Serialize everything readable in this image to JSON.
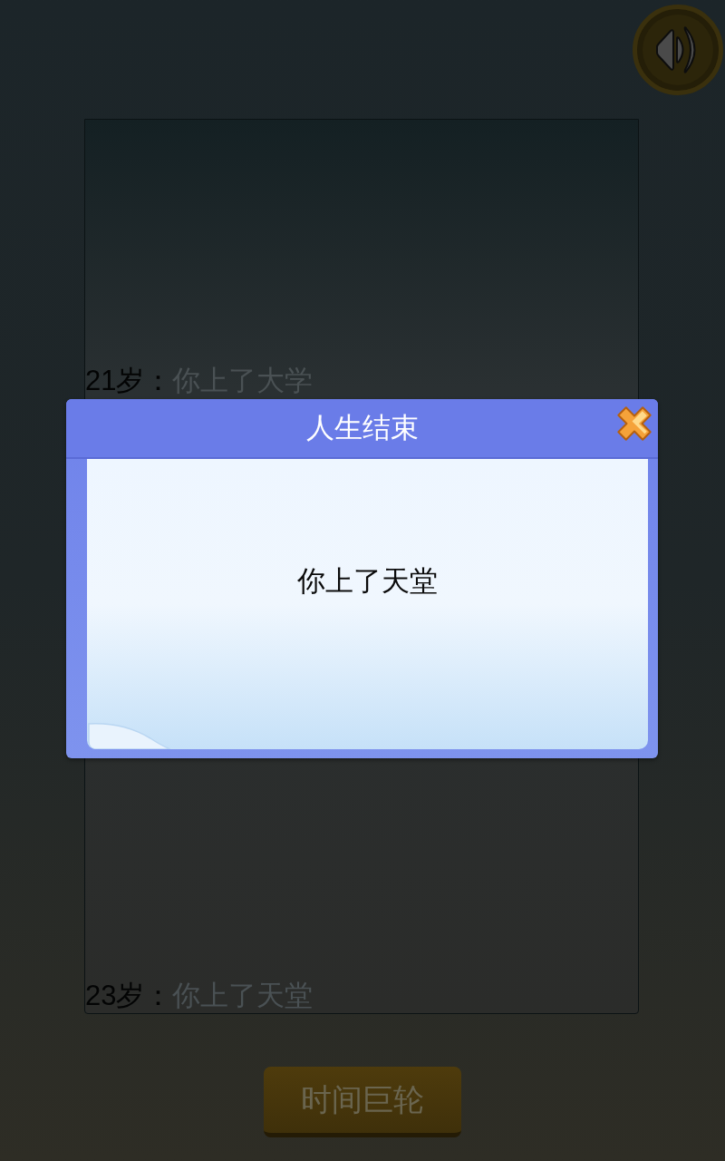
{
  "log": {
    "entries": [
      {
        "age": "21岁：",
        "event": "你上了大学"
      },
      {
        "age": "23岁：",
        "event": "你上了天堂"
      }
    ]
  },
  "dialog": {
    "title": "人生结束",
    "message": "你上了天堂"
  },
  "action_button": {
    "label": "时间巨轮"
  }
}
